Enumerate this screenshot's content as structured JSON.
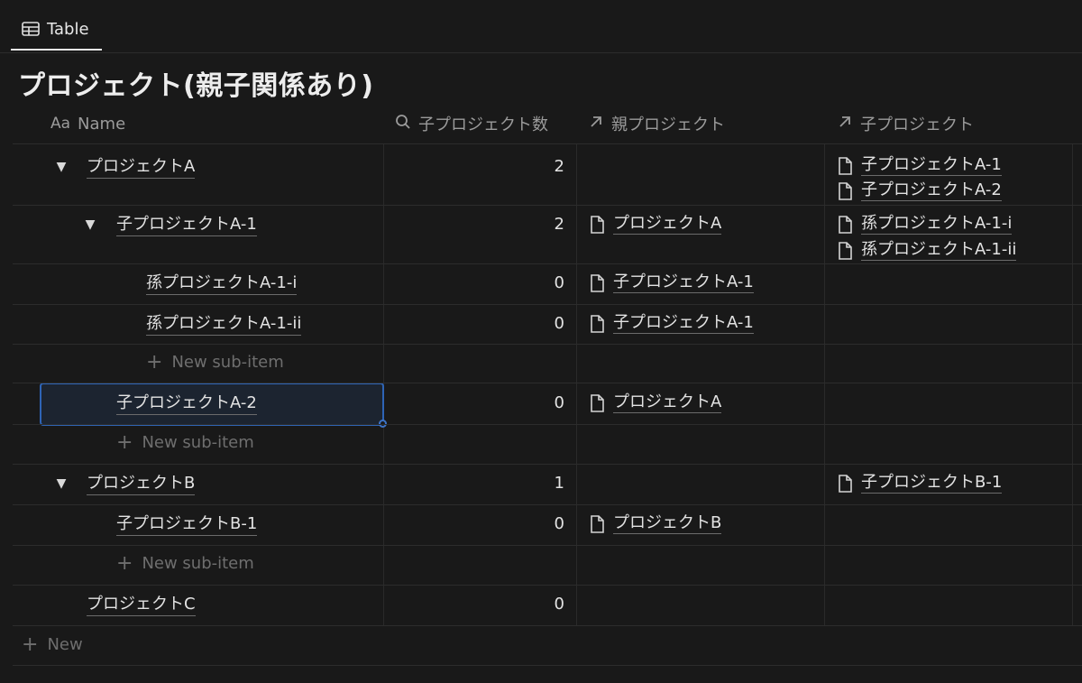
{
  "tab": {
    "label": "Table",
    "icon": "table-icon"
  },
  "page_title": "プロジェクト(親子関係あり)",
  "columns": {
    "name": {
      "prefix": "Aa",
      "label": "Name"
    },
    "count": {
      "label": "子プロジェクト数",
      "icon": "search-icon"
    },
    "parent": {
      "label": "親プロジェクト",
      "icon": "arrow-up-right-icon"
    },
    "children": {
      "label": "子プロジェクト",
      "icon": "arrow-up-right-icon"
    }
  },
  "rows": [
    {
      "name": "プロジェクトA",
      "count": "2",
      "parent": "",
      "children": [
        "子プロジェクトA-1",
        "子プロジェクトA-2"
      ]
    },
    {
      "name": "子プロジェクトA-1",
      "count": "2",
      "parent": "プロジェクトA",
      "children": [
        "孫プロジェクトA-1-i",
        "孫プロジェクトA-1-ii"
      ]
    },
    {
      "name": "孫プロジェクトA-1-i",
      "count": "0",
      "parent": "子プロジェクトA-1",
      "children": []
    },
    {
      "name": "孫プロジェクトA-1-ii",
      "count": "0",
      "parent": "子プロジェクトA-1",
      "children": []
    },
    {
      "name": "子プロジェクトA-2",
      "count": "0",
      "parent": "プロジェクトA",
      "children": []
    },
    {
      "name": "プロジェクトB",
      "count": "1",
      "parent": "",
      "children": [
        "子プロジェクトB-1"
      ]
    },
    {
      "name": "子プロジェクトB-1",
      "count": "0",
      "parent": "プロジェクトB",
      "children": []
    },
    {
      "name": "プロジェクトC",
      "count": "0",
      "parent": "",
      "children": []
    }
  ],
  "new_sub_item_label": "New sub-item",
  "new_label": "New",
  "colors": {
    "background": "#191919",
    "selection": "#2e64b5",
    "text": "#e3e3e3",
    "muted": "#9b9b9b"
  }
}
